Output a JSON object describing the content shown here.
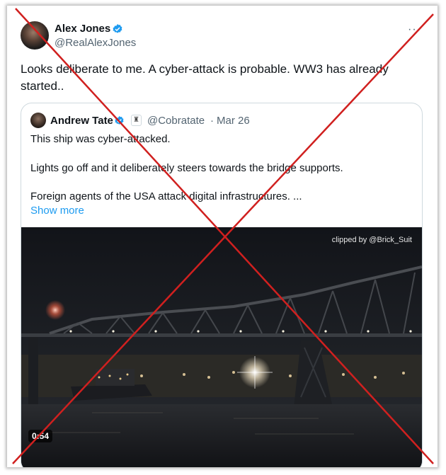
{
  "tweet": {
    "author_name": "Alex Jones",
    "author_handle": "@RealAlexJones",
    "more_label": "···",
    "text": "Looks deliberate to me. A cyber-attack is probable. WW3 has already started..",
    "verified_icon": "verified-badge-icon"
  },
  "quote": {
    "author_name": "Andrew Tate",
    "badge_glyph": "♜",
    "author_handle": "@Cobratate",
    "separator": "·",
    "date": "Mar 26",
    "lines": [
      "This ship was cyber-attacked.",
      "Lights go off and it deliberately steers towards the bridge supports.",
      "Foreign agents of the USA attack digital infrastructures. ..."
    ],
    "show_more": "Show more",
    "video": {
      "watermark": "clipped by @Brick_Suit",
      "duration": "0:54"
    }
  },
  "overlay": {
    "cross_color": "#d0201f",
    "meaning": "red X drawn over the post"
  },
  "colors": {
    "accent": "#1d9bf0",
    "text": "#0f1419",
    "secondary": "#536471",
    "border": "#cfd9de"
  }
}
